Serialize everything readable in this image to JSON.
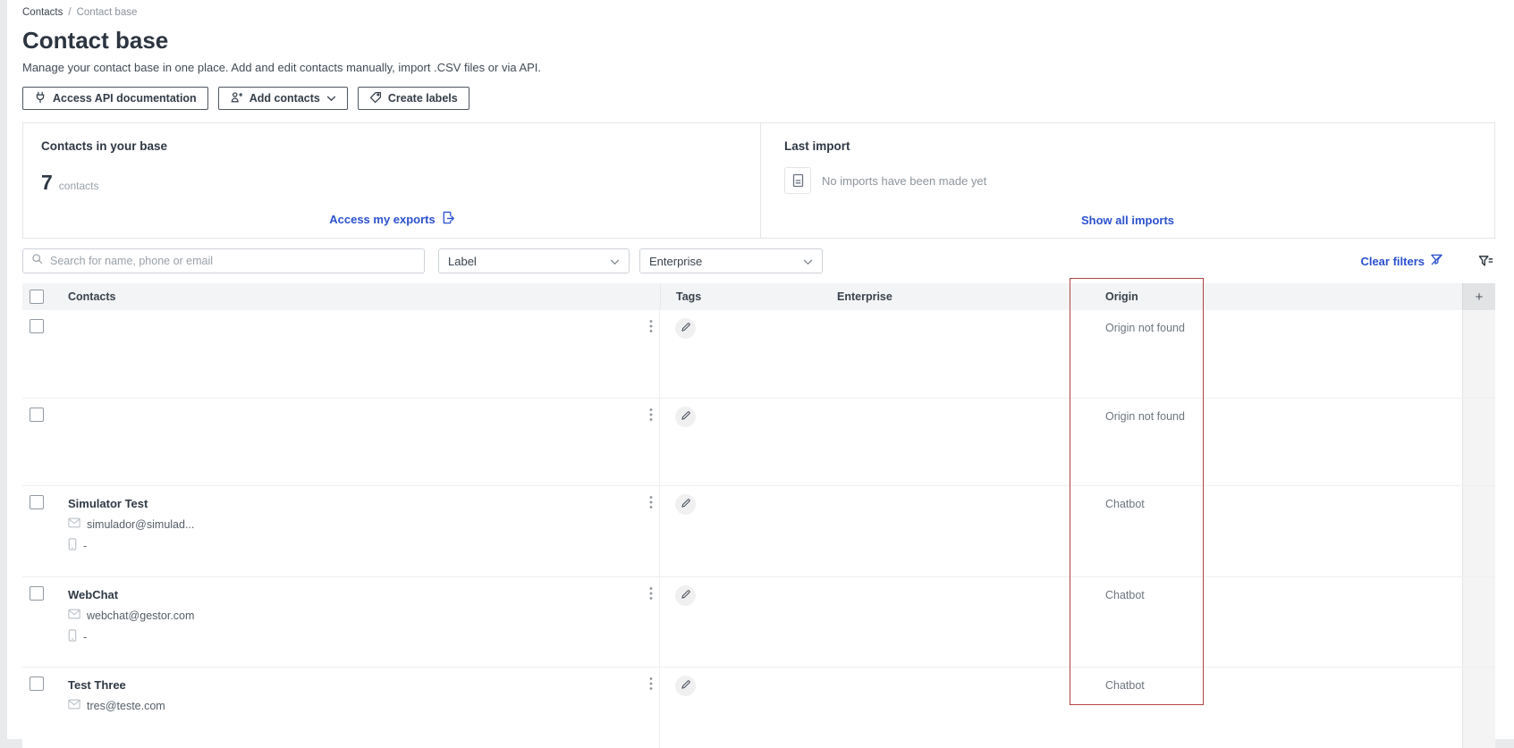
{
  "breadcrumb": {
    "parent": "Contacts",
    "separator": "/",
    "current": "Contact base"
  },
  "header": {
    "title": "Contact base",
    "subtitle": "Manage your contact base in one place. Add and edit contacts manually, import .CSV files or via API."
  },
  "toolbar": {
    "access_api_label": "Access API documentation",
    "add_contacts_label": "Add contacts",
    "create_labels_label": "Create labels"
  },
  "summary": {
    "contacts_card": {
      "title": "Contacts in your base",
      "count": "7",
      "unit": "contacts",
      "exports_link": "Access my exports"
    },
    "import_card": {
      "title": "Last import",
      "empty_message": "No imports have been made yet",
      "show_all_link": "Show all imports"
    }
  },
  "filters": {
    "search_placeholder": "Search for name, phone or email",
    "label_dropdown_value": "Label",
    "enterprise_dropdown_value": "Enterprise",
    "clear_filters_label": "Clear filters"
  },
  "table": {
    "columns": {
      "contacts": "Contacts",
      "tags": "Tags",
      "enterprise": "Enterprise",
      "origin": "Origin",
      "add_column": "+"
    },
    "rows": [
      {
        "name": "",
        "email": "",
        "phone": "",
        "enterprise": "",
        "origin": "Origin not found"
      },
      {
        "name": "",
        "email": "",
        "phone": "",
        "enterprise": "",
        "origin": "Origin not found"
      },
      {
        "name": "Simulator Test",
        "email": "simulador@simulad...",
        "phone": "-",
        "enterprise": "",
        "origin": "Chatbot"
      },
      {
        "name": "WebChat",
        "email": "webchat@gestor.com",
        "phone": "-",
        "enterprise": "",
        "origin": "Chatbot"
      },
      {
        "name": "Test Three",
        "email": "tres@teste.com",
        "phone": "",
        "enterprise": "",
        "origin": "Chatbot"
      }
    ]
  },
  "colors": {
    "link_blue": "#2b50cf",
    "highlight_red": "#b24343"
  }
}
